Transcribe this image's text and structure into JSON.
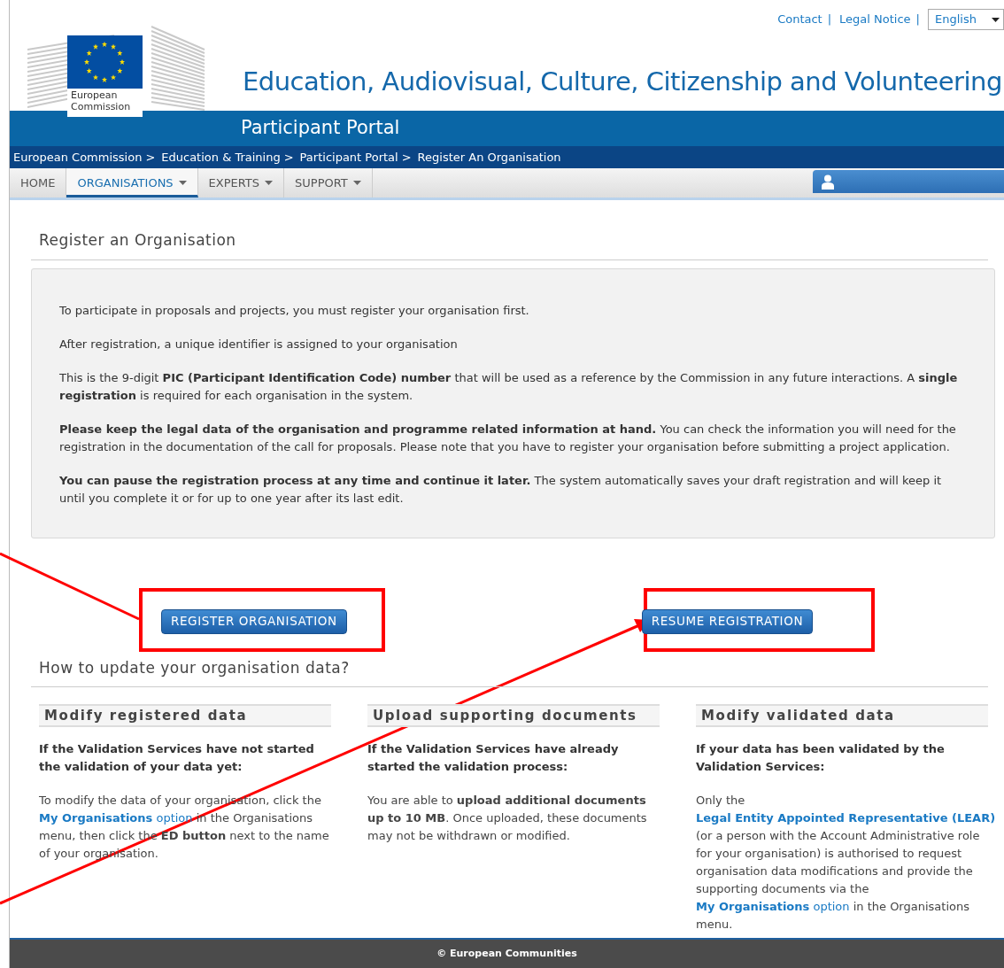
{
  "top_links": [
    {
      "label": "Contact",
      "separator": "|"
    },
    {
      "label": "Legal Notice",
      "separator": "|"
    }
  ],
  "language": {
    "value": "English"
  },
  "logo": {
    "lines": [
      "European",
      "Commission"
    ]
  },
  "header": {
    "title": "Education, Audiovisual, Culture, Citizenship and Volunteering",
    "subtitle": "Participant Portal"
  },
  "breadcrumb": [
    {
      "label": "European Commission",
      "separator": ">"
    },
    {
      "label": "Education & Training",
      "separator": ">"
    },
    {
      "label": "Participant Portal",
      "separator": ">"
    },
    {
      "label": "Register An Organisation"
    }
  ],
  "nav": [
    {
      "label": "HOME",
      "menu": false,
      "selected": false
    },
    {
      "label": "ORGANISATIONS",
      "menu": true,
      "selected": true
    },
    {
      "label": "EXPERTS",
      "menu": true,
      "selected": false
    },
    {
      "label": "SUPPORT",
      "menu": true,
      "selected": false
    }
  ],
  "page_title": "Register an Organisation",
  "intro": [
    "To participate in proposals and projects, you must register your organisation first.",
    "After registration, a unique identifier is assigned to your organisation",
    "This is the 9-digit **PIC (Participant Identification Code) number** that will be used as a reference by the Commission in any future interactions. A **single registration** is required for each organisation in the system.",
    "**Please keep the legal data of the organisation and programme related information at hand.** You can check the information you will need for the registration in the documentation of the call for proposals. Please note that you have to register your organisation before submitting a project application.",
    "**You can pause the registration process at any time and continue it later.** The system automatically saves your draft registration and will keep it until you complete it or for up to one year after its last edit."
  ],
  "buttons": [
    "REGISTER ORGANISATION",
    "RESUME REGISTRATION"
  ],
  "update_title": "How to update your organisation data?",
  "columns": [
    {
      "heading": "Modify registered data",
      "lead": "If the Validation Services have not started the validation of your data yet:",
      "body": [
        {
          "kind": "text",
          "text": "To modify the data of your organisation, click the "
        },
        {
          "kind": "link",
          "text": "**My Organisations** option"
        },
        {
          "kind": "text",
          "text": " in the Organisations menu, then click the **ED button** next to the name of your organisation."
        }
      ]
    },
    {
      "heading": "Upload supporting documents",
      "lead": "If the Validation Services have already started the validation process:",
      "body": [
        {
          "kind": "text",
          "text": "You are able to **upload additional documents up to 10 MB**. Once uploaded, these documents may not be withdrawn or modified."
        }
      ]
    },
    {
      "heading": "Modify validated data",
      "lead": "If your data has been validated by the Validation Services:",
      "body": [
        {
          "kind": "text",
          "text": "Only the "
        },
        {
          "kind": "link",
          "text": "**Legal Entity Appointed Representative (LEAR)**"
        },
        {
          "kind": "text",
          "text": " (or a person with the Account Administrative role for your organisation) is authorised to request organisation data modifications and provide the supporting documents via the "
        },
        {
          "kind": "link",
          "text": "**My Organisations** option"
        },
        {
          "kind": "text",
          "text": " in the Organisations menu."
        }
      ]
    }
  ],
  "footer": "© European Communities"
}
